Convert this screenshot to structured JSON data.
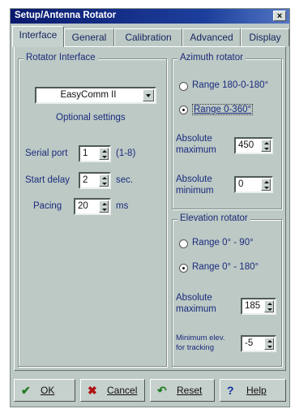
{
  "window": {
    "title": "Setup/Antenna Rotator",
    "close_glyph": "×"
  },
  "tabs": [
    {
      "label": "Interface",
      "active": true
    },
    {
      "label": "General",
      "active": false
    },
    {
      "label": "Calibration",
      "active": false
    },
    {
      "label": "Advanced",
      "active": false
    },
    {
      "label": "Display",
      "active": false
    }
  ],
  "rotator_interface": {
    "title": "Rotator Interface",
    "selected": "EasyComm II",
    "optional_label": "Optional settings",
    "serial_port_label": "Serial port",
    "serial_port_value": "1",
    "serial_port_range": "(1-8)",
    "start_delay_label": "Start delay",
    "start_delay_value": "2",
    "start_delay_unit": "sec.",
    "pacing_label": "Pacing",
    "pacing_value": "20",
    "pacing_unit": "ms"
  },
  "azimuth": {
    "title": "Azimuth rotator",
    "option1": "Range 180-0-180°",
    "option2": "Range 0-360°",
    "selected": "option2",
    "abs_max_label1": "Absolute",
    "abs_max_label2": "maximum",
    "abs_max_value": "450",
    "abs_min_label1": "Absolute",
    "abs_min_label2": "minimum",
    "abs_min_value": "0"
  },
  "elevation": {
    "title": "Elevation rotator",
    "option1": "Range 0° - 90°",
    "option2": "Range 0° - 180°",
    "selected": "option2",
    "abs_max_label1": "Absolute",
    "abs_max_label2": "maximum",
    "abs_max_value": "185",
    "min_elev_label1": "Minimum elev.",
    "min_elev_label2": "for tracking",
    "min_elev_value": "-5"
  },
  "buttons": {
    "ok": "OK",
    "cancel": "Cancel",
    "reset": "Reset",
    "help": "Help"
  },
  "colors": {
    "label_text": "#1b2b7c",
    "ok_icon": "#1a7a1a",
    "cancel_icon": "#b01010",
    "reset_icon": "#1a7a1a",
    "help_icon": "#1030a0"
  }
}
